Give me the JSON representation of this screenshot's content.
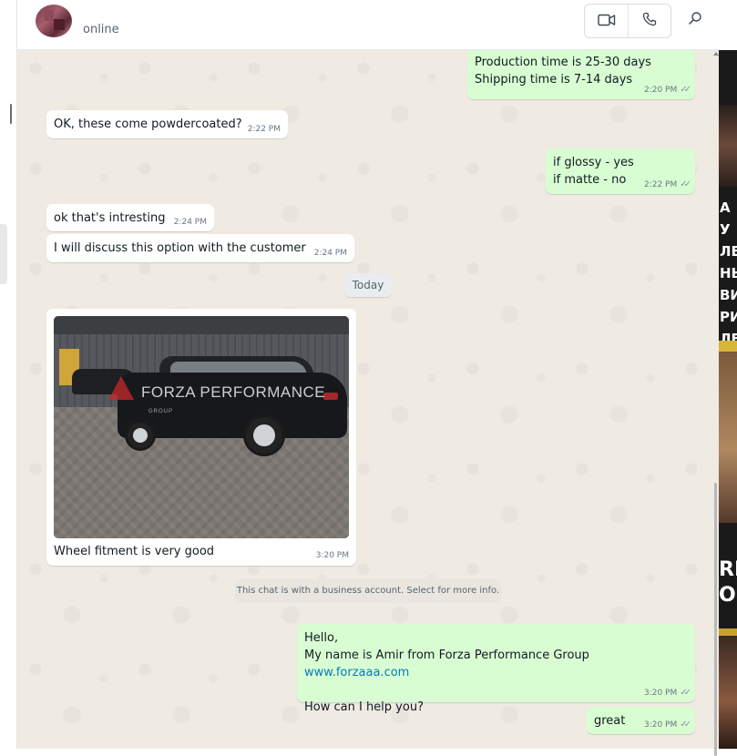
{
  "header": {
    "status": "online",
    "video_call_icon": "video-camera-icon",
    "voice_call_icon": "phone-icon",
    "search_icon": "search-icon"
  },
  "messages": [
    {
      "direction": "out",
      "lines": [
        "Production time is 25-30 days",
        "Shipping time is 7-14 days"
      ],
      "time": "2:20 PM",
      "read": true
    },
    {
      "direction": "in",
      "lines": [
        "OK, these come powdercoated?"
      ],
      "time": "2:22 PM"
    },
    {
      "direction": "out",
      "lines": [
        "if glossy - yes",
        "if matte - no"
      ],
      "time": "2:22 PM",
      "read": true
    },
    {
      "direction": "in",
      "lines": [
        "ok that's intresting"
      ],
      "time": "2:24 PM"
    },
    {
      "direction": "in",
      "lines": [
        "I will discuss this option with the customer"
      ],
      "time": "2:24 PM"
    },
    {
      "direction": "in",
      "type": "image",
      "caption": "Wheel fitment is very good",
      "time": "3:20 PM",
      "watermark": "FORZA PERFORMANCE",
      "watermark_sub": "GROUP"
    },
    {
      "direction": "out",
      "lines": [
        "Hello,",
        "My name is Amir from Forza Performance Group ",
        "",
        "How can I help you?"
      ],
      "link": "www.forzaaa.com",
      "time": "3:20 PM",
      "read": true
    },
    {
      "direction": "out",
      "lines": [
        "great"
      ],
      "time": "3:20 PM",
      "read": true
    }
  ],
  "date_divider": "Today",
  "business_notice": "This chat is with a business account. Select for more info.",
  "colors": {
    "incoming_bubble": "#ffffff",
    "outgoing_bubble": "#d9fdd3",
    "chat_background": "#efeae2",
    "link": "#027eb5"
  },
  "side_panel": {
    "text_lines": [
      "А У",
      "ЛЕ",
      "НЬ",
      "ВИ",
      "РИ",
      "ЛЕ"
    ],
    "text_lines_2": [
      "RE",
      "OF"
    ]
  }
}
